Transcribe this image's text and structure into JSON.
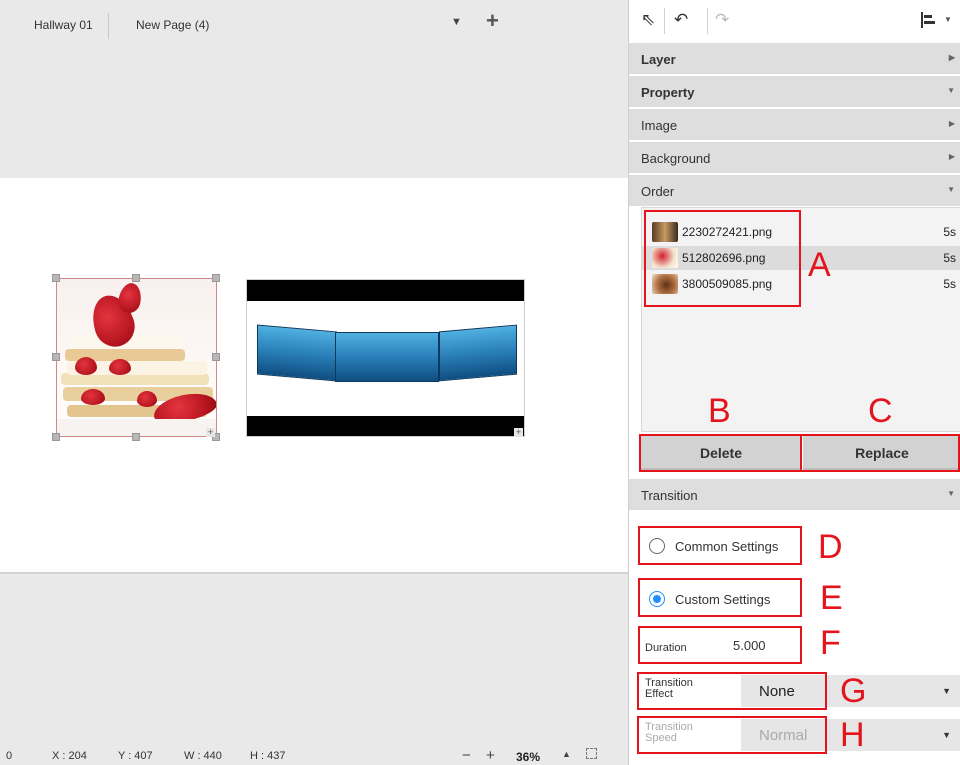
{
  "editor": {
    "tabs": [
      "Hallway 01",
      "New Page (4)"
    ],
    "page_dropdown_icon": "caret-down-icon",
    "add_page_icon": "plus-icon"
  },
  "status": {
    "partial": "0",
    "x": "X : 204",
    "y": "Y : 407",
    "w": "W : 440",
    "h": "H : 437",
    "zoom_minus": "−",
    "zoom_plus": "+",
    "zoom": "36%"
  },
  "toolbar": {
    "icons": [
      "pointer-icon",
      "undo-icon",
      "redo-icon",
      "align-icon"
    ]
  },
  "sections": {
    "layer": "Layer",
    "property": "Property",
    "image": "Image",
    "background": "Background",
    "order": "Order",
    "transition": "Transition"
  },
  "order_items": [
    {
      "file": "2230272421.png",
      "duration": "5s"
    },
    {
      "file": "512802696.png",
      "duration": "5s"
    },
    {
      "file": "3800509085.png",
      "duration": "5s"
    }
  ],
  "buttons": {
    "delete": "Delete",
    "replace": "Replace"
  },
  "transition": {
    "common": "Common Settings",
    "custom": "Custom Settings",
    "selected": "custom",
    "duration_label": "Duration",
    "duration_value": "5.000",
    "effect_label": "Transition Effect",
    "effect_value": "None",
    "speed_label": "Transition Speed",
    "speed_value": "Normal"
  },
  "annotations": {
    "a": "A",
    "b": "B",
    "c": "C",
    "d": "D",
    "e": "E",
    "f": "F",
    "g": "G",
    "h": "H"
  },
  "colors": {
    "annotation_red": "#e5131c",
    "radio_active": "#1e90ff",
    "section_bg": "#dedede"
  }
}
